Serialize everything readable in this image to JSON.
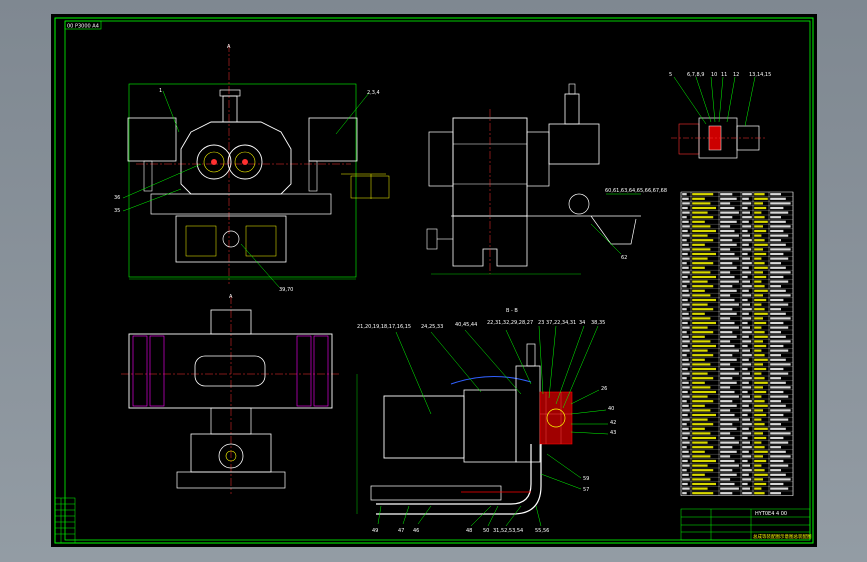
{
  "drawing": {
    "code_box": "00 P3000 A4",
    "section_label": "B - B",
    "title_block_no": "HYT0E4 4 00",
    "title_block_name": "总成等装配图示意图总装配图"
  },
  "front_view": {
    "callouts": [
      "1",
      "2,3,4",
      "36",
      "35",
      "39,70"
    ]
  },
  "side_view": {
    "callouts": [
      "60,61,63,64,65,66,67,68",
      "62"
    ]
  },
  "detail_view": {
    "callouts": [
      "5",
      "6,7,8,9",
      "10",
      "11",
      "12",
      "13,14,15"
    ]
  },
  "section_view": {
    "top_callouts": [
      "21,20,19,18,17,16,15",
      "24,25,33",
      "40,45,44",
      "22,31,32,29,28,27",
      "23",
      "37,22,34,31",
      "34",
      "38,35"
    ],
    "right_callouts": [
      "26",
      "40",
      "42",
      "43",
      "59",
      "57"
    ],
    "bottom_callouts": [
      "49",
      "47",
      "46",
      "48",
      "50",
      "31,52,53,54",
      "55,56"
    ]
  },
  "colors": {
    "line": "#ffffff",
    "accent": "#ffff00",
    "center": "#ff3030",
    "dim": "#00ff00",
    "section": "#ff0000",
    "blue": "#3060ff",
    "magenta": "#ff00ff"
  }
}
